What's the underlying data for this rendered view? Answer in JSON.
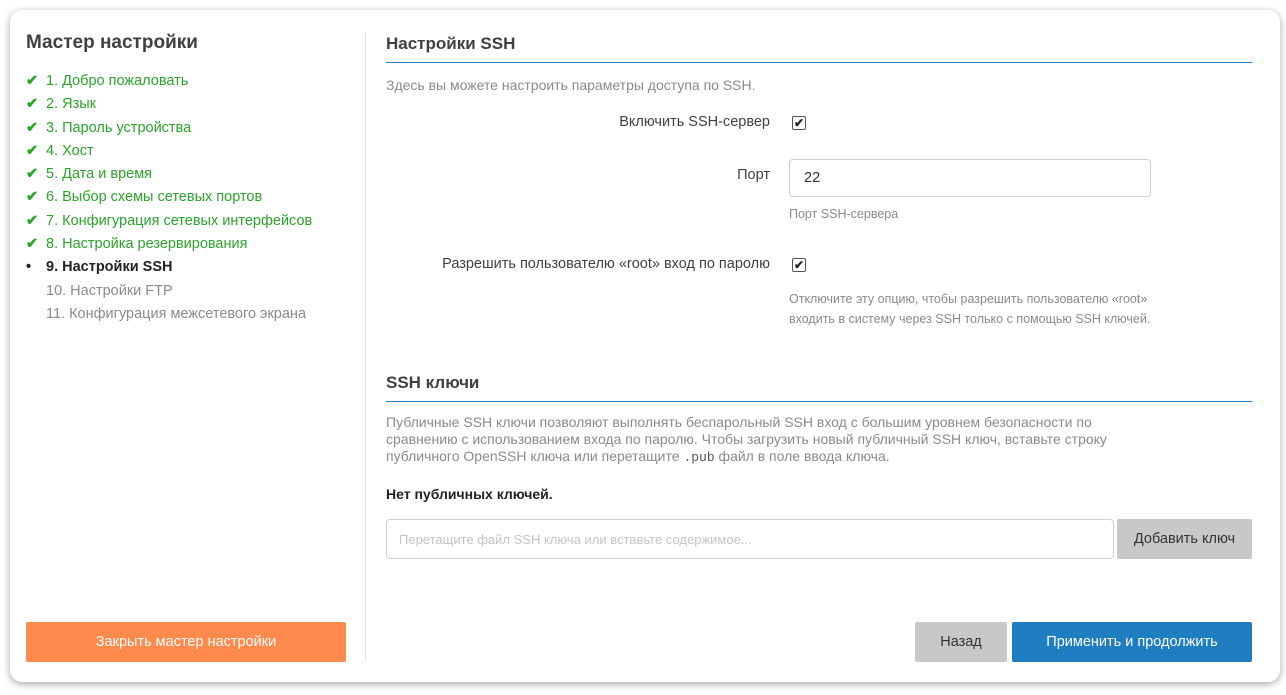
{
  "sidebar": {
    "title": "Мастер настройки",
    "steps": [
      {
        "label": "1. Добро пожаловать",
        "state": "done",
        "mark": "✔"
      },
      {
        "label": "2. Язык",
        "state": "done",
        "mark": "✔"
      },
      {
        "label": "3. Пароль устройства",
        "state": "done",
        "mark": "✔"
      },
      {
        "label": "4. Хост",
        "state": "done",
        "mark": "✔"
      },
      {
        "label": "5. Дата и время",
        "state": "done",
        "mark": "✔"
      },
      {
        "label": "6. Выбор схемы сетевых портов",
        "state": "done",
        "mark": "✔"
      },
      {
        "label": "7. Конфигурация сетевых интерфейсов",
        "state": "done",
        "mark": "✔"
      },
      {
        "label": "8. Настройка резервирования",
        "state": "done",
        "mark": "✔"
      },
      {
        "label": "9. Настройки SSH",
        "state": "active",
        "mark": "•"
      },
      {
        "label": "10. Настройки FTP",
        "state": "future",
        "mark": ""
      },
      {
        "label": "11. Конфигурация межсетевого экрана",
        "state": "future",
        "mark": ""
      }
    ],
    "close_button": "Закрыть мастер настройки"
  },
  "ssh_settings": {
    "title": "Настройки SSH",
    "description": "Здесь вы можете настроить параметры доступа по SSH.",
    "enable_label": "Включить SSH-сервер",
    "enable_checked": true,
    "port_label": "Порт",
    "port_value": "22",
    "port_hint": "Порт SSH-сервера",
    "root_label": "Разрешить пользователю «root» вход по паролю",
    "root_checked": true,
    "root_hint_line1": "Отключите эту опцию, чтобы разрешить пользователю «root»",
    "root_hint_line2": "входить в систему через SSH только с помощью SSH ключей."
  },
  "ssh_keys": {
    "title": "SSH ключи",
    "desc_line1": "Публичные SSH ключи позволяют выполнять беспарольный SSH вход с большим уровнем безопасности по",
    "desc_line2": "сравнению с использованием входа по паролю. Чтобы загрузить новый публичный SSH ключ, вставьте строку",
    "desc_line3_pre": "публичного OpenSSH ключа или перетащите ",
    "desc_line3_code": ".pub",
    "desc_line3_post": " файл в поле ввода ключа.",
    "no_keys": "Нет публичных ключей.",
    "input_placeholder": "Перетащите файл SSH ключа или вставьте содержимое...",
    "add_button": "Добавить ключ"
  },
  "footer": {
    "back_button": "Назад",
    "apply_button": "Применить и продолжить"
  },
  "colors": {
    "accent": "#1f7ec2",
    "done": "#2aa52a",
    "close_button": "#ff8a4c"
  }
}
